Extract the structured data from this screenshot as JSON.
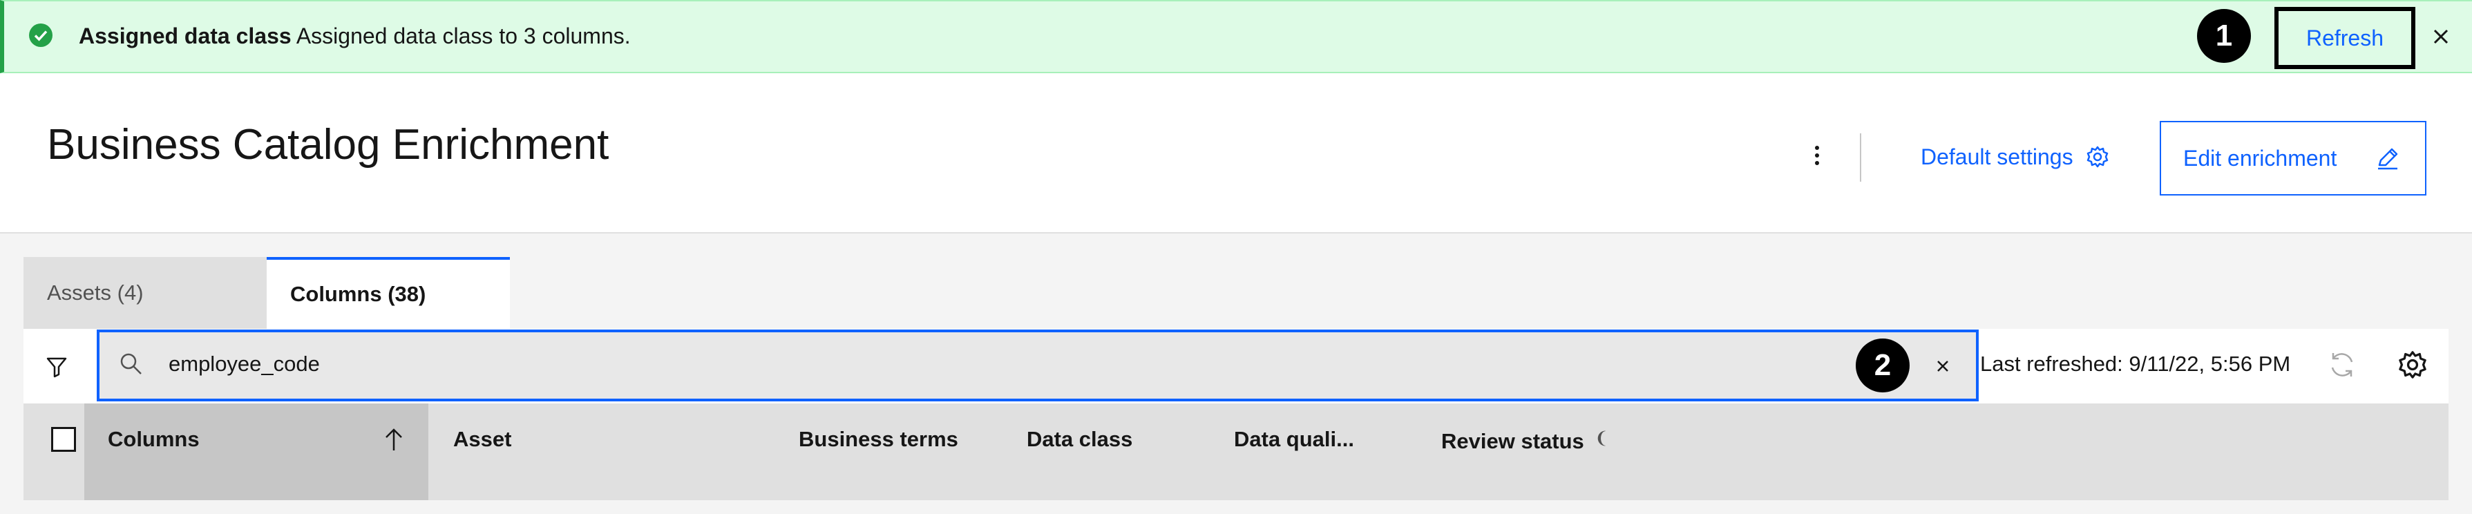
{
  "notification": {
    "title": "Assigned data class",
    "message": "Assigned data class to 3 columns.",
    "action_label": "Refresh",
    "status_color": "#24a148",
    "icons": {
      "status": "checkmark-filled-icon",
      "close": "close-icon"
    }
  },
  "callouts": {
    "one": "1",
    "two": "2"
  },
  "header": {
    "title": "Business Catalog Enrichment",
    "default_settings_label": "Default settings",
    "edit_label": "Edit enrichment",
    "icons": {
      "overflow": "overflow-menu-vertical-icon",
      "settings": "gear-icon",
      "edit": "pencil-icon"
    }
  },
  "tabs": [
    {
      "label": "Assets (4)",
      "selected": false
    },
    {
      "label": "Columns (38)",
      "selected": true
    }
  ],
  "toolbar": {
    "search_value": "employee_code",
    "last_refreshed": "Last refreshed: 9/11/22, 5:56 PM",
    "icons": {
      "filter": "filter-icon",
      "search": "search-icon",
      "clear": "close-icon",
      "reload": "renew-icon",
      "settings": "gear-icon"
    }
  },
  "table": {
    "columns": [
      "Columns",
      "Asset",
      "Business terms",
      "Data class",
      "Data quali...",
      "Review status"
    ],
    "sorted_column": "Columns",
    "sort_direction": "ascending"
  },
  "colors": {
    "accent": "#0f62fe",
    "success_bg": "#defbe6",
    "success": "#24a148"
  }
}
